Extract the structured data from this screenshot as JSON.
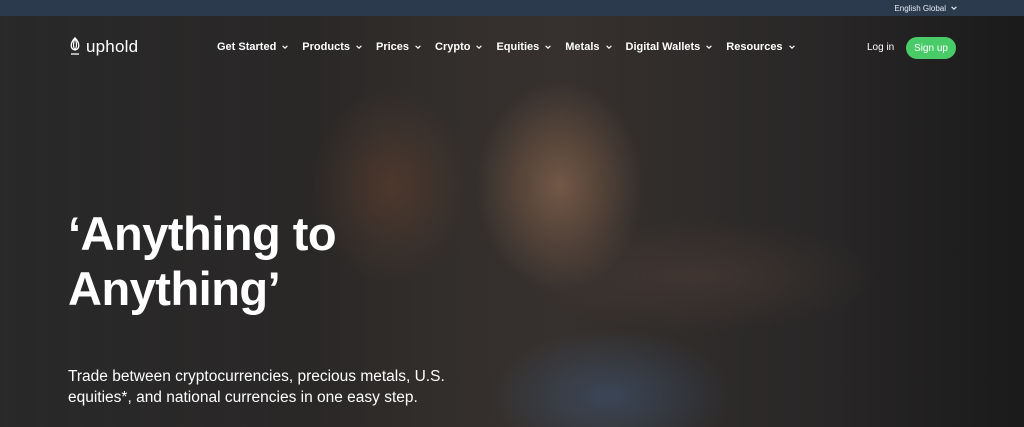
{
  "topbar": {
    "language_label": "English Global"
  },
  "brand": {
    "name": "uphold"
  },
  "nav": {
    "items": [
      {
        "label": "Get Started"
      },
      {
        "label": "Products"
      },
      {
        "label": "Prices"
      },
      {
        "label": "Crypto"
      },
      {
        "label": "Equities"
      },
      {
        "label": "Metals"
      },
      {
        "label": "Digital Wallets"
      },
      {
        "label": "Resources"
      }
    ],
    "login_label": "Log in",
    "signup_label": "Sign up"
  },
  "hero": {
    "headline_line1": "‘Anything to",
    "headline_line2": "Anything’",
    "subtext": "Trade between cryptocurrencies, precious metals, U.S. equities*, and national currencies in one easy step."
  },
  "colors": {
    "topbar_bg": "#2c3a4e",
    "signup_bg": "#49cc68",
    "text": "#ffffff"
  },
  "icons": {
    "logo": "uphold-logo-icon",
    "dropdown": "chevron-down-icon"
  }
}
